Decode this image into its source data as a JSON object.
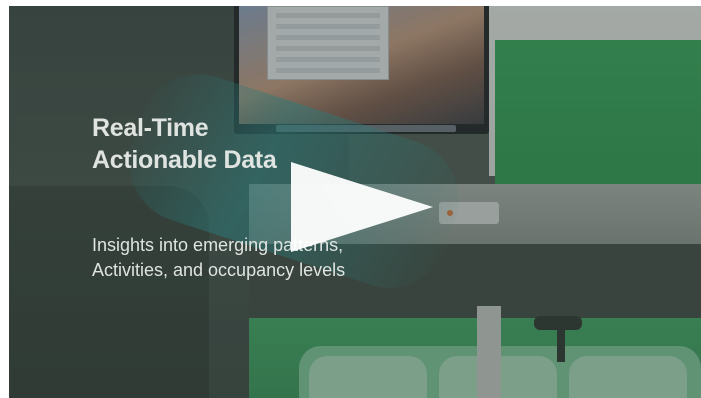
{
  "video": {
    "headline_line1": "Real-Time",
    "headline_line2": "Actionable Data",
    "subtitle_line1": "Insights into emerging patterns,",
    "subtitle_line2": "Activities, and occupancy levels",
    "play_icon": "play-icon",
    "text_color": "#dfe4e1",
    "accent_green": "#33a85a"
  }
}
